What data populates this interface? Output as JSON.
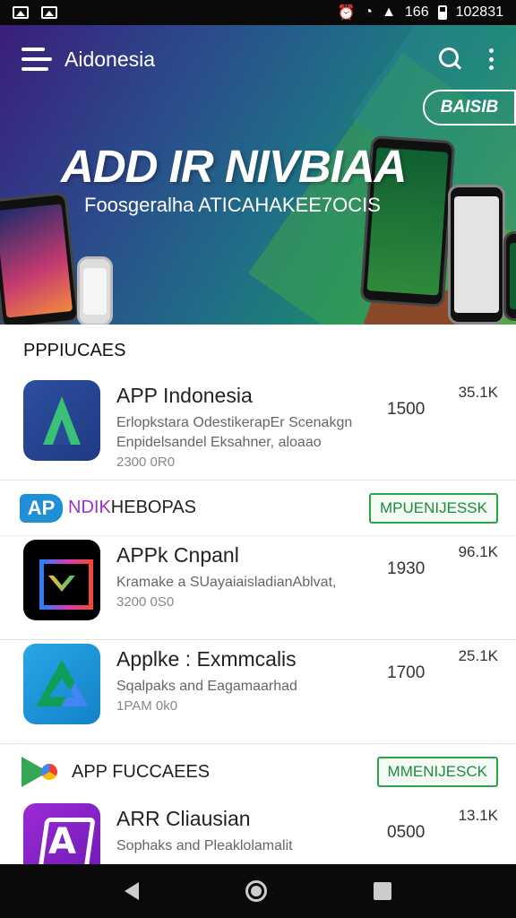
{
  "status_bar": {
    "signal": "166",
    "time": "102831"
  },
  "app_bar": {
    "title": "Aidonesia"
  },
  "hero": {
    "badge": "BAISIB",
    "title": "ADD IR NIVBIAA",
    "subtitle": "Foosgeralha ATICAHAKEE7OCIS",
    "slides": 3,
    "active_slide": 1
  },
  "section": {
    "heading": "PPPIUCAES"
  },
  "apps": [
    {
      "name": "APP Indonesia",
      "desc1": "Erlopkstara OdestikerapEr Scenakgn",
      "desc2": "Enpidelsandel Eksahner, aloaao",
      "meta": "2300 0R0",
      "count": "1500",
      "size": "35.1K"
    },
    {
      "name": "APPk Cnpanl",
      "desc1": "Kramake a SUayaiaisladianAblvat,",
      "desc2": "",
      "meta": "3200 0S0",
      "count": "1930",
      "size": "96.1K"
    },
    {
      "name": "Applke : Exmmcalis",
      "desc1": "Sqalpaks and Eagamaarhad",
      "desc2": "",
      "meta": "1PAM 0k0",
      "count": "1700",
      "size": "25.1K"
    },
    {
      "name": "ARR Cliausian",
      "desc1": "Sophaks and Pleaklolamalit",
      "desc2": "",
      "meta": "",
      "count": "0500",
      "size": "13.1K"
    }
  ],
  "brand_bar_1": {
    "logo": "AP",
    "text_accent": "NDIK",
    "text_rest": "HEBOPAS",
    "button": "MPUENIJESSK"
  },
  "brand_bar_2": {
    "text": "APP FUCCAEES",
    "button": "MMENIJESCK"
  },
  "colors": {
    "accent_green": "#2ca24a",
    "brand_blue": "#1f8fd6",
    "brand_purple": "#9b30c8"
  },
  "icons": [
    "image-icon",
    "gallery-icon",
    "alarm-icon",
    "wifi-icon",
    "signal-icon",
    "battery-icon",
    "menu-icon",
    "search-icon",
    "more-vert-icon",
    "back-icon",
    "home-icon",
    "recents-icon"
  ]
}
